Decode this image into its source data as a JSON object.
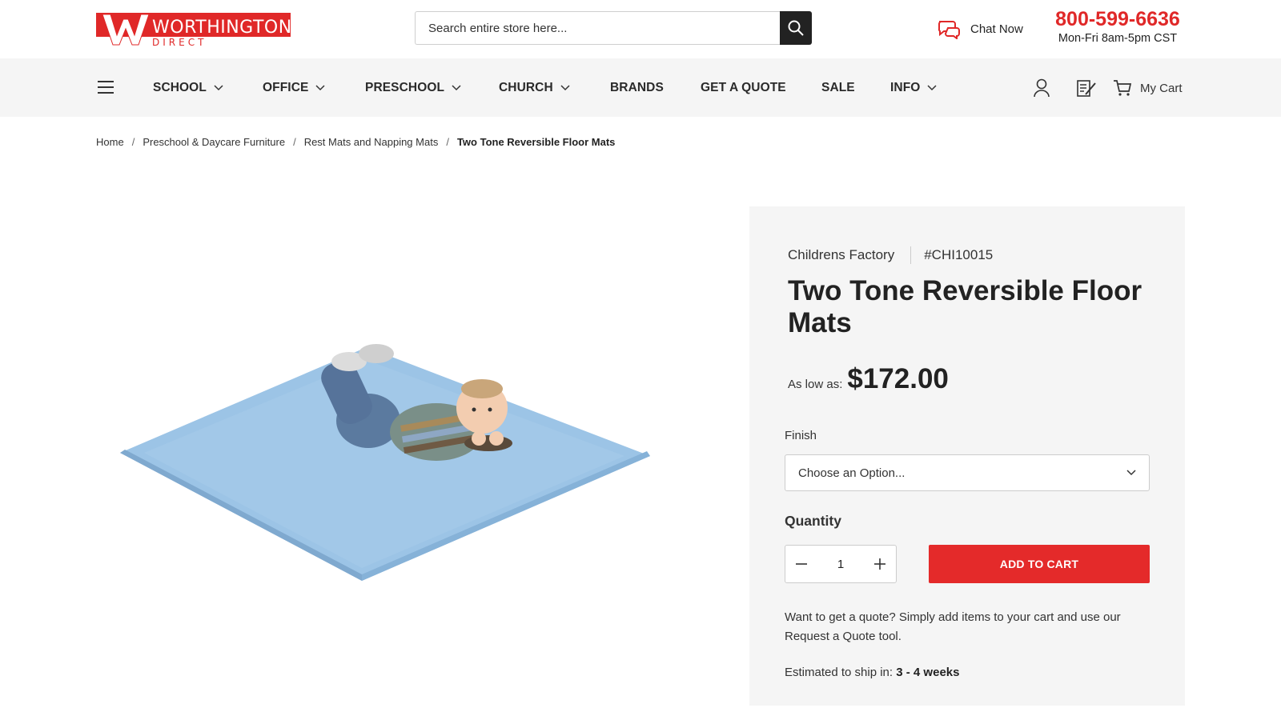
{
  "header": {
    "logo_main": "WORTHINGTON",
    "logo_sub": "DIRECT",
    "search_placeholder": "Search entire store here...",
    "chat_label": "Chat Now",
    "phone": "800-599-6636",
    "hours": "Mon-Fri 8am-5pm CST",
    "brand_color": "#e02828"
  },
  "nav": {
    "items": [
      {
        "label": "SCHOOL",
        "dropdown": true
      },
      {
        "label": "OFFICE",
        "dropdown": true
      },
      {
        "label": "PRESCHOOL",
        "dropdown": true
      },
      {
        "label": "CHURCH",
        "dropdown": true
      },
      {
        "label": "BRANDS",
        "dropdown": false
      },
      {
        "label": "GET A QUOTE",
        "dropdown": false
      },
      {
        "label": "SALE",
        "dropdown": false
      },
      {
        "label": "INFO",
        "dropdown": true
      }
    ],
    "cart_label": "My Cart"
  },
  "breadcrumb": [
    "Home",
    "Preschool & Daycare Furniture",
    "Rest Mats and Napping Mats",
    "Two Tone Reversible Floor Mats"
  ],
  "product": {
    "brand": "Childrens Factory",
    "sku": "#CHI10015",
    "title": "Two Tone Reversible Floor Mats",
    "price_label": "As low as:",
    "price": "$172.00",
    "finish_label": "Finish",
    "finish_placeholder": "Choose an Option...",
    "quantity_label": "Quantity",
    "quantity": "1",
    "add_to_cart": "ADD TO CART",
    "quote_text": "Want to get a quote? Simply add items to your cart and use our Request a Quote tool.",
    "ship_label": "Estimated to ship in:",
    "ship_value": "3 - 4 weeks",
    "button_color": "#e42a2a"
  }
}
